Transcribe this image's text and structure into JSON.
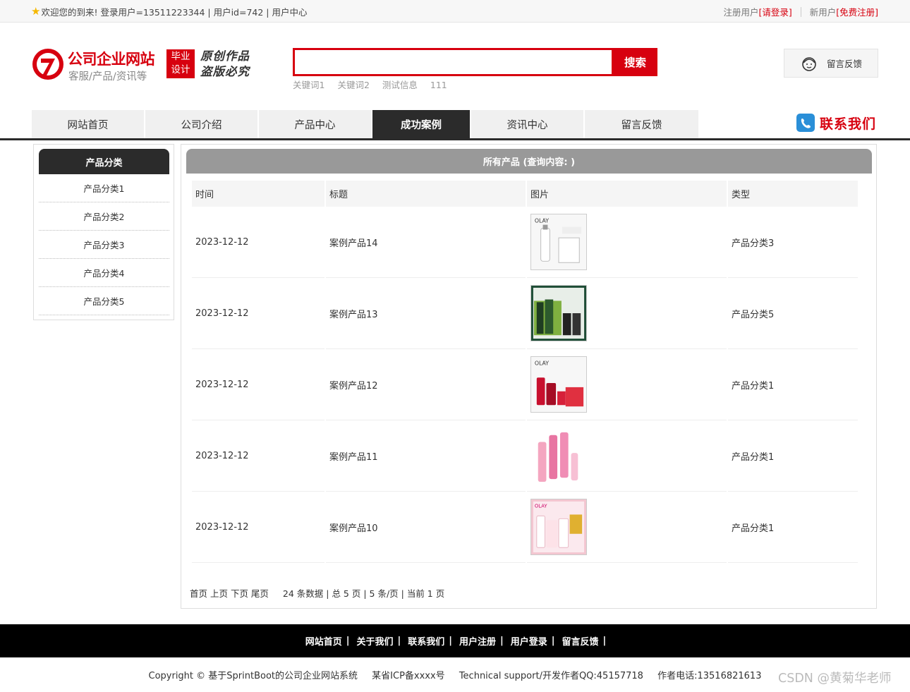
{
  "topbar": {
    "welcome": "欢迎您的到来!",
    "user_info": "登录用户=13511223344 | 用户id=742 | 用户中心",
    "register_label": "注册用户",
    "login_link": "[请登录]",
    "newuser_label": "新用户",
    "free_register_link": "[免费注册]"
  },
  "logo": {
    "title": "公司企业网站",
    "subtitle": "客服/产品/资讯等",
    "badge_line1": "毕业",
    "badge_line2": "设计",
    "hand_line1": "原创作品",
    "hand_line2": "盗版必究"
  },
  "search": {
    "value": "",
    "button": "搜索",
    "keywords": [
      "关键词1",
      "关键词2",
      "测试信息",
      "111"
    ]
  },
  "feedback_button": "留言反馈",
  "nav": {
    "items": [
      "网站首页",
      "公司介绍",
      "产品中心",
      "成功案例",
      "资讯中心",
      "留言反馈"
    ],
    "active": "成功案例",
    "contact": "联系我们"
  },
  "sidebar": {
    "title": "产品分类",
    "items": [
      "产品分类1",
      "产品分类2",
      "产品分类3",
      "产品分类4",
      "产品分类5"
    ]
  },
  "main": {
    "title": "所有产品 (查询内容: )",
    "columns": [
      "时间",
      "标题",
      "图片",
      "类型"
    ],
    "rows": [
      {
        "date": "2023-12-12",
        "title": "案例产品14",
        "type": "产品分类3",
        "image": "olay-white-serum"
      },
      {
        "date": "2023-12-12",
        "title": "案例产品13",
        "type": "产品分类5",
        "image": "green-tea-set"
      },
      {
        "date": "2023-12-12",
        "title": "案例产品12",
        "type": "产品分类1",
        "image": "olay-red-set"
      },
      {
        "date": "2023-12-12",
        "title": "案例产品11",
        "type": "产品分类1",
        "image": "pink-bottles"
      },
      {
        "date": "2023-12-12",
        "title": "案例产品10",
        "type": "产品分类1",
        "image": "olay-pink-set"
      }
    ],
    "pager": {
      "links": "首页 上页 下页 尾页",
      "summary": "24 条数据 | 总 5 页 | 5 条/页 | 当前 1 页"
    }
  },
  "footer": {
    "links": [
      "网站首页",
      "关于我们",
      "联系我们",
      "用户注册",
      "用户登录",
      "留言反馈"
    ],
    "copyright": "Copyright © 基于SprintBoot的公司企业网站系统",
    "icp": "某省ICP备xxxx号",
    "support": "Technical support/开发作者QQ:45157718",
    "phone": "作者电话:13516821613"
  },
  "watermark": "CSDN @黄菊华老师",
  "colors": {
    "accent": "#d7000f",
    "dark": "#2b2b2b",
    "grey_header": "#999999"
  }
}
